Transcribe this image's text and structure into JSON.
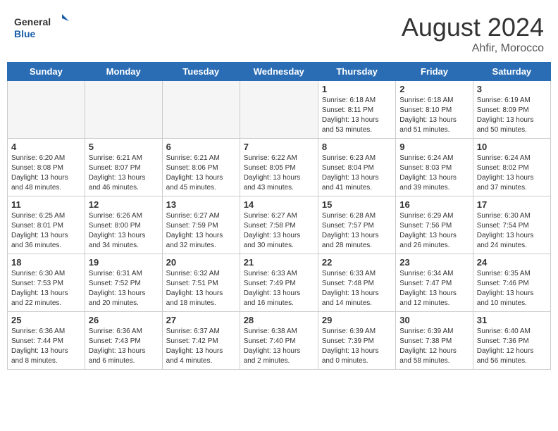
{
  "header": {
    "logo_general": "General",
    "logo_blue": "Blue",
    "month_year": "August 2024",
    "location": "Ahfir, Morocco"
  },
  "days_of_week": [
    "Sunday",
    "Monday",
    "Tuesday",
    "Wednesday",
    "Thursday",
    "Friday",
    "Saturday"
  ],
  "weeks": [
    [
      {
        "day": "",
        "info": ""
      },
      {
        "day": "",
        "info": ""
      },
      {
        "day": "",
        "info": ""
      },
      {
        "day": "",
        "info": ""
      },
      {
        "day": "1",
        "info": "Sunrise: 6:18 AM\nSunset: 8:11 PM\nDaylight: 13 hours\nand 53 minutes."
      },
      {
        "day": "2",
        "info": "Sunrise: 6:18 AM\nSunset: 8:10 PM\nDaylight: 13 hours\nand 51 minutes."
      },
      {
        "day": "3",
        "info": "Sunrise: 6:19 AM\nSunset: 8:09 PM\nDaylight: 13 hours\nand 50 minutes."
      }
    ],
    [
      {
        "day": "4",
        "info": "Sunrise: 6:20 AM\nSunset: 8:08 PM\nDaylight: 13 hours\nand 48 minutes."
      },
      {
        "day": "5",
        "info": "Sunrise: 6:21 AM\nSunset: 8:07 PM\nDaylight: 13 hours\nand 46 minutes."
      },
      {
        "day": "6",
        "info": "Sunrise: 6:21 AM\nSunset: 8:06 PM\nDaylight: 13 hours\nand 45 minutes."
      },
      {
        "day": "7",
        "info": "Sunrise: 6:22 AM\nSunset: 8:05 PM\nDaylight: 13 hours\nand 43 minutes."
      },
      {
        "day": "8",
        "info": "Sunrise: 6:23 AM\nSunset: 8:04 PM\nDaylight: 13 hours\nand 41 minutes."
      },
      {
        "day": "9",
        "info": "Sunrise: 6:24 AM\nSunset: 8:03 PM\nDaylight: 13 hours\nand 39 minutes."
      },
      {
        "day": "10",
        "info": "Sunrise: 6:24 AM\nSunset: 8:02 PM\nDaylight: 13 hours\nand 37 minutes."
      }
    ],
    [
      {
        "day": "11",
        "info": "Sunrise: 6:25 AM\nSunset: 8:01 PM\nDaylight: 13 hours\nand 36 minutes."
      },
      {
        "day": "12",
        "info": "Sunrise: 6:26 AM\nSunset: 8:00 PM\nDaylight: 13 hours\nand 34 minutes."
      },
      {
        "day": "13",
        "info": "Sunrise: 6:27 AM\nSunset: 7:59 PM\nDaylight: 13 hours\nand 32 minutes."
      },
      {
        "day": "14",
        "info": "Sunrise: 6:27 AM\nSunset: 7:58 PM\nDaylight: 13 hours\nand 30 minutes."
      },
      {
        "day": "15",
        "info": "Sunrise: 6:28 AM\nSunset: 7:57 PM\nDaylight: 13 hours\nand 28 minutes."
      },
      {
        "day": "16",
        "info": "Sunrise: 6:29 AM\nSunset: 7:56 PM\nDaylight: 13 hours\nand 26 minutes."
      },
      {
        "day": "17",
        "info": "Sunrise: 6:30 AM\nSunset: 7:54 PM\nDaylight: 13 hours\nand 24 minutes."
      }
    ],
    [
      {
        "day": "18",
        "info": "Sunrise: 6:30 AM\nSunset: 7:53 PM\nDaylight: 13 hours\nand 22 minutes."
      },
      {
        "day": "19",
        "info": "Sunrise: 6:31 AM\nSunset: 7:52 PM\nDaylight: 13 hours\nand 20 minutes."
      },
      {
        "day": "20",
        "info": "Sunrise: 6:32 AM\nSunset: 7:51 PM\nDaylight: 13 hours\nand 18 minutes."
      },
      {
        "day": "21",
        "info": "Sunrise: 6:33 AM\nSunset: 7:49 PM\nDaylight: 13 hours\nand 16 minutes."
      },
      {
        "day": "22",
        "info": "Sunrise: 6:33 AM\nSunset: 7:48 PM\nDaylight: 13 hours\nand 14 minutes."
      },
      {
        "day": "23",
        "info": "Sunrise: 6:34 AM\nSunset: 7:47 PM\nDaylight: 13 hours\nand 12 minutes."
      },
      {
        "day": "24",
        "info": "Sunrise: 6:35 AM\nSunset: 7:46 PM\nDaylight: 13 hours\nand 10 minutes."
      }
    ],
    [
      {
        "day": "25",
        "info": "Sunrise: 6:36 AM\nSunset: 7:44 PM\nDaylight: 13 hours\nand 8 minutes."
      },
      {
        "day": "26",
        "info": "Sunrise: 6:36 AM\nSunset: 7:43 PM\nDaylight: 13 hours\nand 6 minutes."
      },
      {
        "day": "27",
        "info": "Sunrise: 6:37 AM\nSunset: 7:42 PM\nDaylight: 13 hours\nand 4 minutes."
      },
      {
        "day": "28",
        "info": "Sunrise: 6:38 AM\nSunset: 7:40 PM\nDaylight: 13 hours\nand 2 minutes."
      },
      {
        "day": "29",
        "info": "Sunrise: 6:39 AM\nSunset: 7:39 PM\nDaylight: 13 hours\nand 0 minutes."
      },
      {
        "day": "30",
        "info": "Sunrise: 6:39 AM\nSunset: 7:38 PM\nDaylight: 12 hours\nand 58 minutes."
      },
      {
        "day": "31",
        "info": "Sunrise: 6:40 AM\nSunset: 7:36 PM\nDaylight: 12 hours\nand 56 minutes."
      }
    ]
  ]
}
